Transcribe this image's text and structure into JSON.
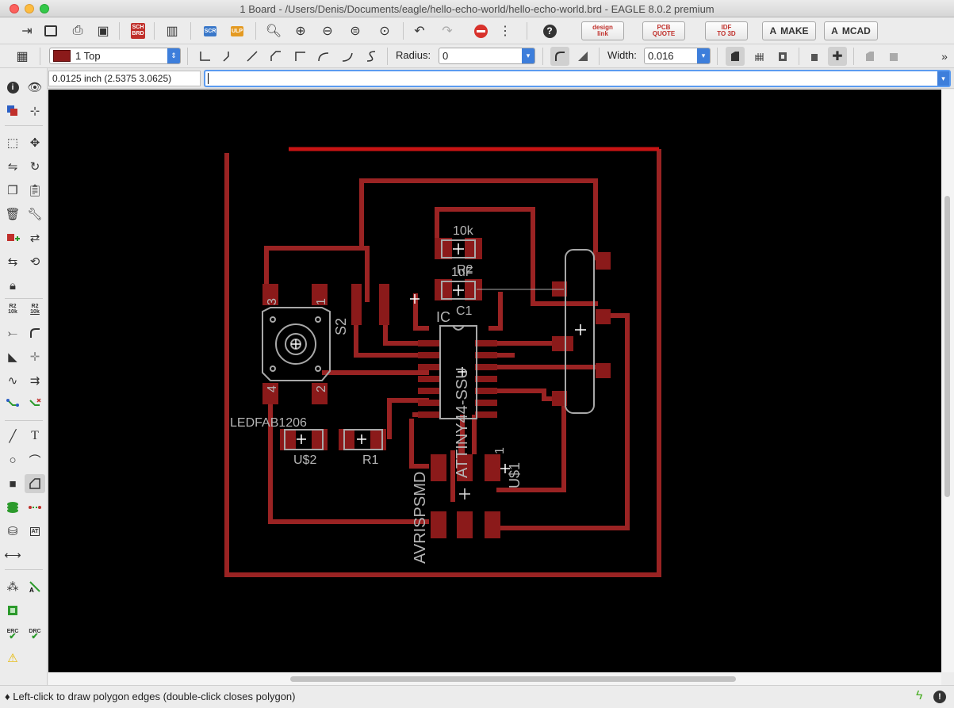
{
  "window": {
    "title": "1 Board - /Users/Denis/Documents/eagle/hello-echo-world/hello-echo-world.brd - EAGLE 8.0.2 premium"
  },
  "toolbar": {
    "design_link_line1": "design",
    "design_link_line2": "link",
    "pcb_quote_line1": "PCB",
    "pcb_quote_line2": "QUOTE",
    "idf_line1": "IDF",
    "idf_line2": "TO 3D",
    "make_label": "MAKE",
    "mcad_label": "MCAD",
    "sch_line1": "SCH",
    "sch_line2": "BRD",
    "scr_label": "SCR",
    "ulp_label": "ULP"
  },
  "params": {
    "layer_label": "1 Top",
    "radius_label": "Radius:",
    "radius_value": "0",
    "width_label": "Width:",
    "width_value": "0.016"
  },
  "coordinate_display": "0.0125 inch (2.5375 3.0625)",
  "command_line": {
    "value": ""
  },
  "palette": {
    "r2_10k_top": "R2",
    "r2_10k_bottom": "10k",
    "r2_10k_alt_top": "R2",
    "r2_10k_alt_bottom": "10k",
    "erc_label": "ERC",
    "drc_label": "DRC"
  },
  "board": {
    "labels": {
      "r10k": "10k",
      "r2": "R2",
      "c1uf": "1uF",
      "c1": "C1",
      "ic": "IC",
      "attiny": "ATTINY44-SSU",
      "s2": "S2",
      "pin3": "3",
      "pin1": "1",
      "pin4": "4",
      "pin2": "2",
      "ledfab": "LEDFAB1206",
      "us2": "U$2",
      "r1": "R1",
      "avrisp": "AVRISPSMD",
      "us1_pin": "1",
      "us1": "U$1"
    }
  },
  "status": {
    "message": "Left-click to draw polygon edges (double-click closes polygon)"
  },
  "colors": {
    "copper": "#8b1a1a",
    "trace": "#9a2323",
    "outline_highlight": "#c81414",
    "silk": "#a8a8a8",
    "canvas_bg": "#000000"
  }
}
